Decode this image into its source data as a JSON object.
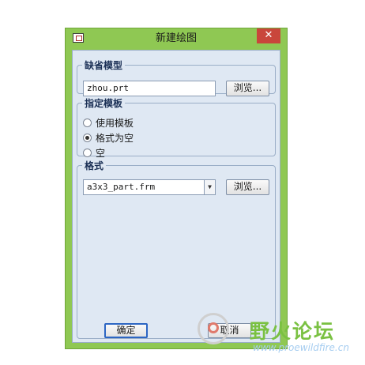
{
  "window": {
    "title": "新建绘图",
    "close_glyph": "✕"
  },
  "default_model": {
    "legend": "缺省模型",
    "input_value": "zhou.prt",
    "browse_label": "浏览..."
  },
  "template": {
    "legend": "指定模板",
    "options": [
      {
        "label": "使用模板",
        "checked": false
      },
      {
        "label": "格式为空",
        "checked": true
      },
      {
        "label": "空",
        "checked": false
      }
    ]
  },
  "format": {
    "legend": "格式",
    "selected_value": "a3x3_part.frm",
    "dropdown_arrow": "▼",
    "browse_label": "浏览..."
  },
  "buttons": {
    "ok_label": "确定",
    "cancel_label": "取消"
  },
  "watermark": {
    "text": "野火论坛",
    "url": "www.proewildfire.cn"
  },
  "colors": {
    "frame_green": "#8fc853",
    "close_red": "#c9463b",
    "client_bg": "#dfe8f3",
    "legend_blue": "#1a2f55",
    "watermark_green": "#7ac142"
  }
}
